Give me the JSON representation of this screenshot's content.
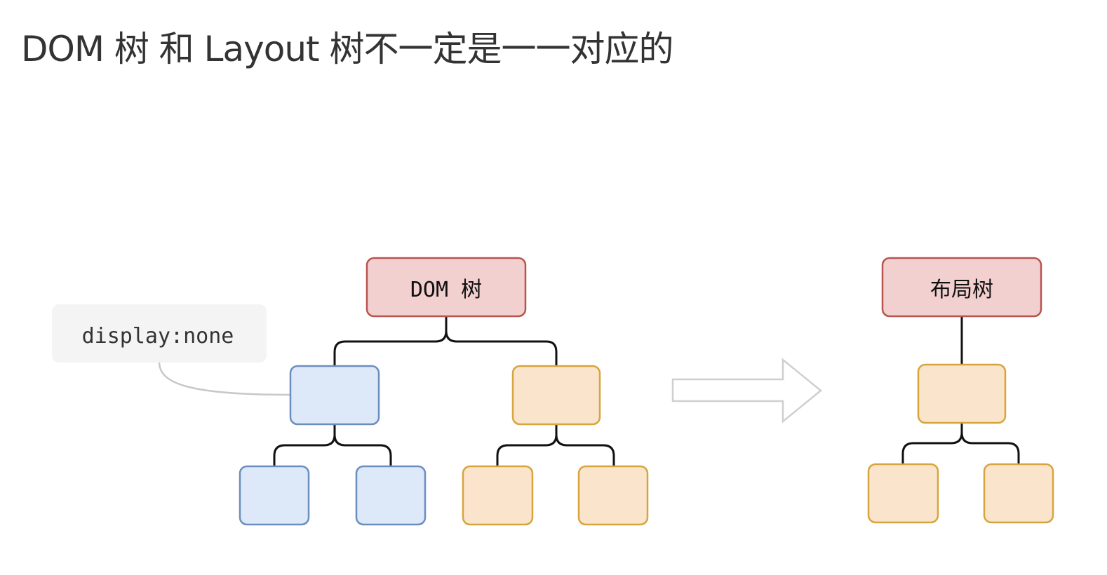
{
  "title": "DOM 树 和 Layout 树不一定是一一对应的",
  "diagram": {
    "dom_tree_label": "DOM 树",
    "layout_tree_label": "布局树",
    "note_label": "display:none"
  },
  "colors": {
    "root_fill": "#f2d0cf",
    "root_stroke": "#b85450",
    "hidden_fill": "#dde8f8",
    "hidden_stroke": "#6c8ebf",
    "visible_fill": "#fae5cc",
    "visible_stroke": "#d6a53e",
    "note_fill": "#f4f4f4",
    "connector": "#111111",
    "callout": "#c8c8c8",
    "arrow": "#cfcfcf"
  }
}
